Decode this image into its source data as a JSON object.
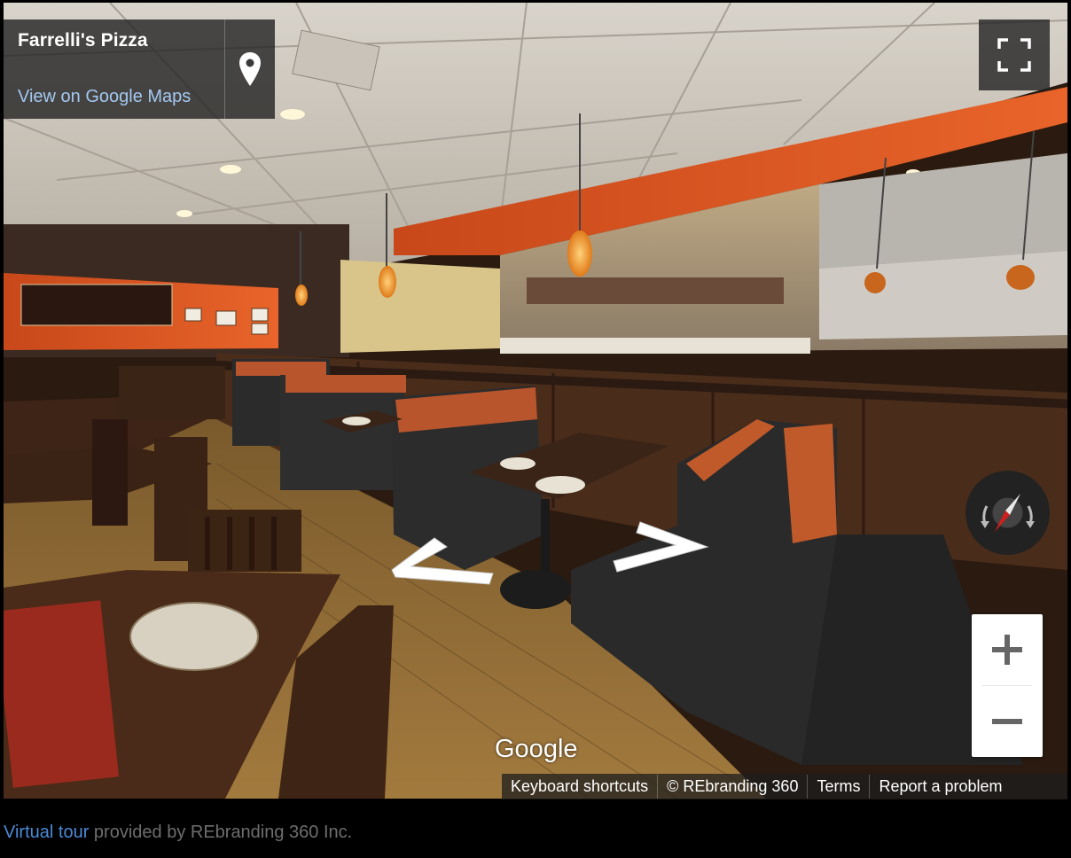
{
  "info_card": {
    "place_name": "Farrelli's Pizza",
    "maps_link": "View on Google Maps"
  },
  "icons": {
    "pin": "map-pin-icon",
    "fullscreen": "fullscreen-icon",
    "compass": "compass-icon",
    "zoom_in": "plus-icon",
    "zoom_out": "minus-icon",
    "nav_left": "chevron-left-icon",
    "nav_right": "chevron-right-icon"
  },
  "google_logo": "Google",
  "attribution": {
    "keyboard_shortcuts": "Keyboard shortcuts",
    "copyright": "© REbranding 360",
    "terms": "Terms",
    "report": "Report a problem"
  },
  "caption": {
    "link_text": "Virtual tour",
    "rest_text": " provided by REbranding 360 Inc."
  },
  "colors": {
    "link_blue": "#4b8ad6",
    "maps_link": "#a4c8f0",
    "wall_orange": "#e0561c",
    "booth_black": "#2b2b2b"
  }
}
